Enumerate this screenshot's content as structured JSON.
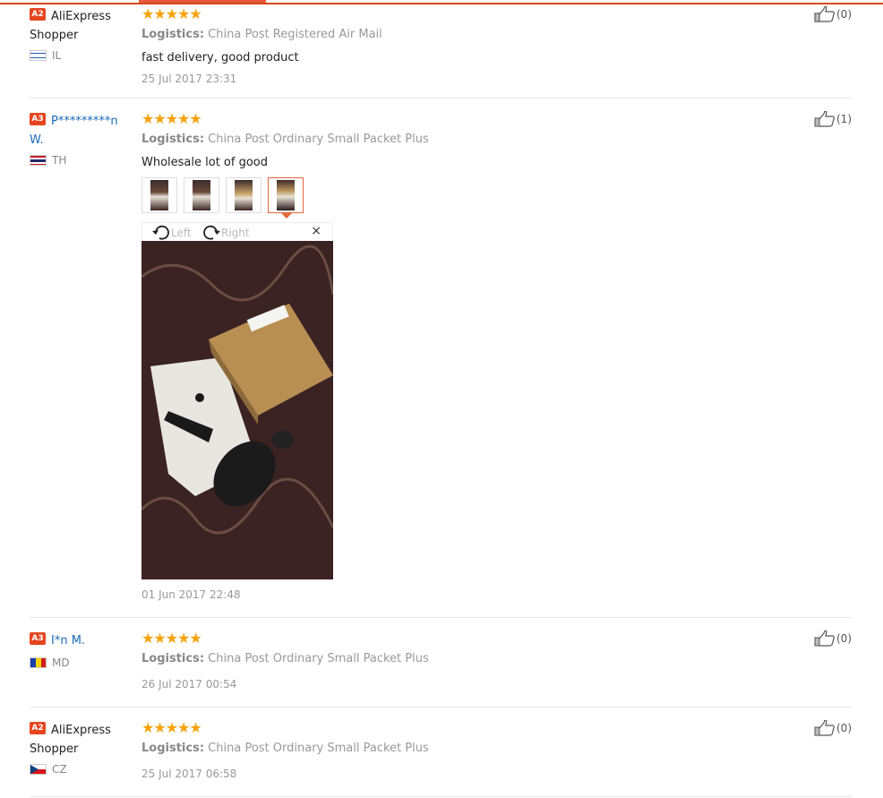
{
  "reviews": [
    {
      "level": "A2",
      "name": "AliExpress Shopper",
      "country": "IL",
      "stars": "★★★★★",
      "logistics_label": "Logistics:",
      "logistics_value": "China Post Registered Air Mail",
      "text": "fast delivery, good product",
      "date": "25 Jul 2017 23:31",
      "likes": "(0)"
    },
    {
      "level": "A3",
      "name": "P*********n W.",
      "country": "TH",
      "stars": "★★★★★",
      "logistics_label": "Logistics:",
      "logistics_value": "China Post Ordinary Small Packet Plus",
      "text": "Wholesale lot of good",
      "date": "01 Jun 2017 22:48",
      "likes": "(1)",
      "viewer": {
        "left_label": "Left",
        "right_label": "Right",
        "close": "×"
      }
    },
    {
      "level": "A3",
      "name": "I*n M.",
      "country": "MD",
      "stars": "★★★★★",
      "logistics_label": "Logistics:",
      "logistics_value": "China Post Ordinary Small Packet Plus",
      "date": "26 Jul 2017 00:54",
      "likes": "(0)"
    },
    {
      "level": "A2",
      "name": "AliExpress Shopper",
      "country": "CZ",
      "stars": "★★★★★",
      "logistics_label": "Logistics:",
      "logistics_value": "China Post Ordinary Small Packet Plus",
      "date": "25 Jul 2017 06:58",
      "likes": "(0)"
    }
  ],
  "colors": {
    "accent": "#e4593a",
    "star": "#f5a20a",
    "level_badge": "#e5451f",
    "link": "#1a6ab8"
  },
  "icons": {
    "like": "thumbs-up-icon",
    "rotate_left": "rotate-left-icon",
    "rotate_right": "rotate-right-icon",
    "close": "close-icon"
  }
}
